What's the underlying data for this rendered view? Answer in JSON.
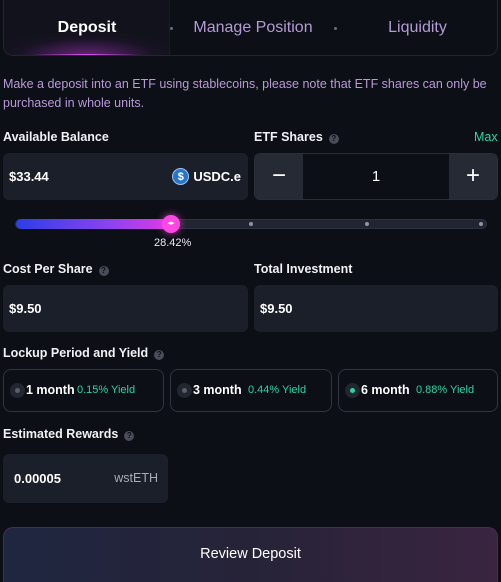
{
  "tabs": [
    {
      "label": "Deposit",
      "active": true
    },
    {
      "label": "Manage Position",
      "active": false
    },
    {
      "label": "Liquidity",
      "active": false
    }
  ],
  "intro_text": "Make a deposit into an ETF using stablecoins, please note that ETF shares can only be purchased in whole units.",
  "available_balance": {
    "label": "Available Balance",
    "value": "$33.44",
    "token": "USDC.e",
    "icon": "usdc-icon"
  },
  "etf_shares": {
    "label": "ETF Shares",
    "max_label": "Max",
    "value": "1",
    "minus": "−",
    "plus": "+"
  },
  "slider": {
    "percent_label": "28.42%",
    "fraction": 0.3304
  },
  "cost_per_share": {
    "label": "Cost Per Share",
    "value": "$9.50"
  },
  "total_investment": {
    "label": "Total Investment",
    "value": "$9.50"
  },
  "lockup": {
    "label": "Lockup Period and Yield",
    "options": [
      {
        "term": "1 month",
        "yield": "0.15% Yield",
        "selected": false
      },
      {
        "term": "3 month",
        "yield": "0.44% Yield",
        "selected": false
      },
      {
        "term": "6 month",
        "yield": "0.88% Yield",
        "selected": true
      }
    ]
  },
  "estimated_rewards": {
    "label": "Estimated Rewards",
    "value": "0.00005",
    "unit": "wstETH"
  },
  "review_button": "Review Deposit",
  "colors": {
    "accent_green": "#28d6a0",
    "accent_pink": "#ff47e3",
    "background": "#0c0f16",
    "field": "#1b1f29"
  }
}
